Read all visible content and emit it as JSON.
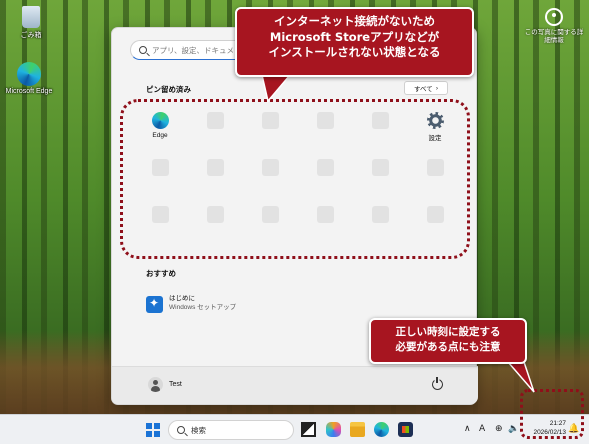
{
  "desktop": {
    "icons": [
      {
        "label": "ごみ箱",
        "icon": "recycle-bin-icon"
      },
      {
        "label": "Microsoft Edge",
        "icon": "edge-icon"
      }
    ],
    "photo_info": {
      "label": "この写真に関する詳細情報",
      "icon": "info-ring-icon"
    }
  },
  "start_menu": {
    "search_placeholder": "アプリ、設定、ドキュメントの検索",
    "pinned_title": "ピン留め済み",
    "all_button": "すべて",
    "pinned": [
      {
        "label": "Edge",
        "icon": "edge-icon"
      },
      {
        "label": "",
        "icon": "placeholder"
      },
      {
        "label": "",
        "icon": "placeholder"
      },
      {
        "label": "",
        "icon": "placeholder"
      },
      {
        "label": "",
        "icon": "placeholder"
      },
      {
        "label": "設定",
        "icon": "gear-icon"
      }
    ],
    "recommended_title": "おすすめ",
    "recommended": [
      {
        "title": "はじめに",
        "subtitle": "Windows セットアップ",
        "icon": "get-started-icon"
      }
    ],
    "user": {
      "name": "Test"
    }
  },
  "taskbar": {
    "search_label": "検索",
    "apps": [
      "task-view-icon",
      "copilot-icon",
      "file-explorer-icon",
      "edge-icon",
      "store-icon"
    ],
    "tray": {
      "chevron": "∧",
      "ime": "A"
    },
    "clock": {
      "time": "21:27",
      "date": "2026/02/13"
    }
  },
  "annotations": {
    "callout1": {
      "lines": [
        "インターネット接続がないため",
        "Microsoft Storeアプリなどが",
        "インストールされない状態となる"
      ]
    },
    "callout2": {
      "lines": [
        "正しい時刻に設定する",
        "必要がある点にも注意"
      ]
    },
    "accent": "#a71520"
  }
}
